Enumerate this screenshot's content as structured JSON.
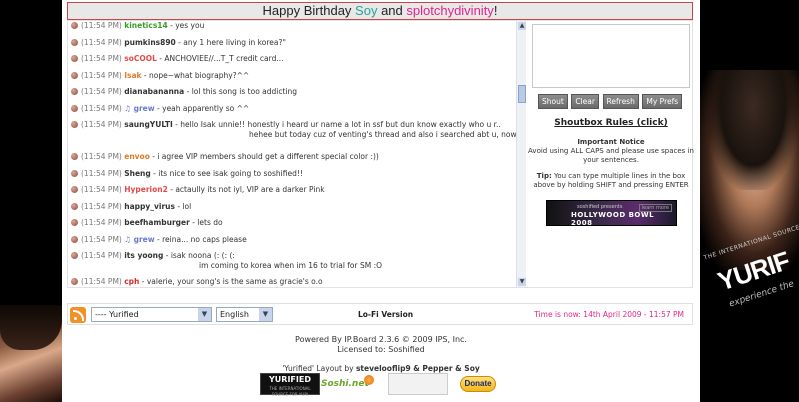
{
  "banner": {
    "prefix": "Happy Birthday ",
    "name1": "Soy",
    "mid": " and ",
    "name2": "splotchydivinity",
    "suffix": "!"
  },
  "shouts": [
    {
      "time": "(11:54 PM)",
      "user": "kinetics14",
      "color": "#3a9d2b",
      "text": " - yes you",
      "cont": ""
    },
    {
      "time": "(11:54 PM)",
      "user": "pumkins890",
      "color": "#333333",
      "text": " - any 1 here living in korea?\"",
      "cont": ""
    },
    {
      "time": "(11:54 PM)",
      "user": "soCOOL",
      "color": "#e04a4a",
      "text": " - ANCHOVIEE//...T_T credit card...",
      "cont": ""
    },
    {
      "time": "(11:54 PM)",
      "user": "Isak",
      "color": "#e07a2a",
      "text": " - nope~what biography?^^",
      "cont": ""
    },
    {
      "time": "(11:54 PM)",
      "user": "dianabananna",
      "color": "#333333",
      "text": " - lol this song is too addicting",
      "cont": ""
    },
    {
      "time": "(11:54 PM)",
      "user": "♫ grew",
      "color": "#6a7acd",
      "text": " - yeah apparently so ^^",
      "cont": ""
    },
    {
      "time": "(11:54 PM)",
      "user": "saungYULTI",
      "color": "#333333",
      "text": " - hello Isak unnie!! honestly i heard ur name a lot in ssf but dun know exactly who u r..",
      "cont": "hehee but today cuz of venting's thread and also i searched abt u, now i think i know u, unnie :D"
    },
    {
      "time": "(11:54 PM)",
      "user": "envoo",
      "color": "#e07a2a",
      "text": " - i agree VIP members should get a different special color :))",
      "cont": ""
    },
    {
      "time": "(11:54 PM)",
      "user": "Sheng",
      "color": "#333333",
      "text": " - its nice to see isak going to soshified!!",
      "cont": ""
    },
    {
      "time": "(11:54 PM)",
      "user": "Hyperion2",
      "color": "#e04a4a",
      "text": " - actaully its not iyl, VIP are a darker Pink",
      "cont": ""
    },
    {
      "time": "(11:54 PM)",
      "user": "happy_virus",
      "color": "#333333",
      "text": " - lol",
      "cont": ""
    },
    {
      "time": "(11:54 PM)",
      "user": "beefhamburger",
      "color": "#333333",
      "text": " - lets do",
      "cont": ""
    },
    {
      "time": "(11:54 PM)",
      "user": "♫ grew",
      "color": "#6a7acd",
      "text": " - reina... no caps please",
      "cont": ""
    },
    {
      "time": "(11:54 PM)",
      "user": "its yoong",
      "color": "#333333",
      "text": " - isak noona (: (: (:",
      "cont": "im coming to korea when im 16 to trial for SM :O"
    },
    {
      "time": "(11:54 PM)",
      "user": "cph",
      "color": "#d42a2a",
      "text": " - valerie, your song's is the same as gracie's o.o",
      "cont": ""
    }
  ],
  "sidebar": {
    "buttons": [
      "Shout",
      "Clear",
      "Refresh",
      "My Prefs"
    ],
    "rules_title": "Shoutbox Rules (click)",
    "notice_title": "Important Notice",
    "notice_text": "Avoid using ALL CAPS and please use spaces in your sentences.",
    "tip_label": "Tip:",
    "tip_text": " You can type multiple lines in the box above by holding SHIFT and pressing ENTER",
    "ad_small": "soshified presents",
    "ad_title": "HOLLYWOOD BOWL 2008",
    "ad_more": "learn more"
  },
  "footer": {
    "skin_select": "---- Yurified",
    "lang_select": "English",
    "lofi": "Lo-Fi Version",
    "time_now": "Time is now: 14th April 2009 - 11:57 PM"
  },
  "powered": {
    "line1": "Powered By IP.Board 2.3.6 © 2009  IPS, Inc.",
    "line2": "Licensed to: Soshified"
  },
  "layout_credit": {
    "prefix": "'Yurified' Layout by ",
    "authors": "stevelooflip9 & Pepper & Soy"
  },
  "badges": {
    "yurified": "YURIFIED",
    "yurified_sub": "THE INTERNATIONAL SOURCE FOR YURI",
    "soshi": "Soshi.net",
    "donate": "Donate"
  },
  "side_art": {
    "tag_small": "THE INTERNATIONAL SOURCE FOR",
    "tag_big": "YURIF",
    "tag_sub": "experience the"
  }
}
